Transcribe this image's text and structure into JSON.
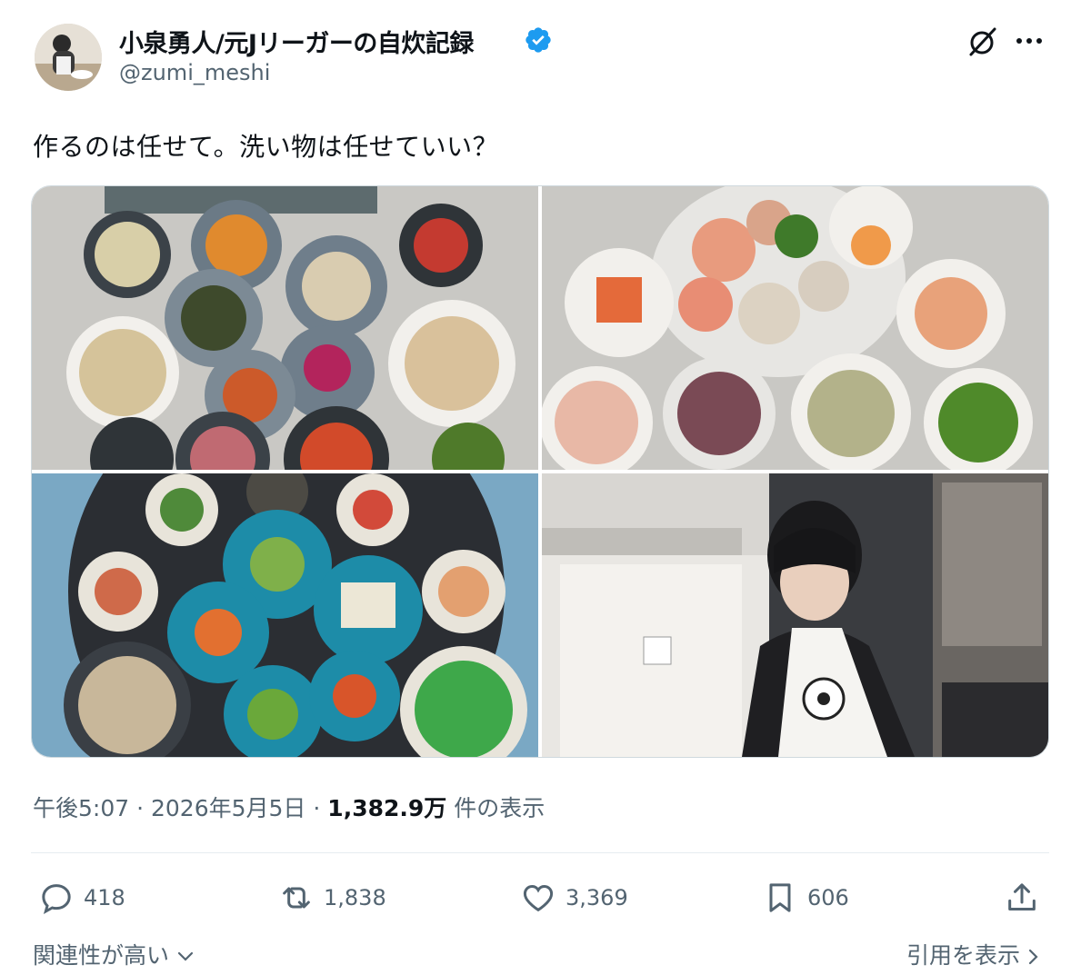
{
  "author": {
    "display_name": "小泉勇人/元Jリーガーの自炊記録",
    "handle": "@zumi_meshi",
    "verified_icon": "verified-badge-icon"
  },
  "header_icons": [
    "grok-icon",
    "more-icon"
  ],
  "tweet": {
    "text": "作るのは任せて。洗い物は任せていい？"
  },
  "media": {
    "images": [
      "food-spread-grey-table",
      "plates-with-egg-and-soup",
      "blue-plates-on-round-tray",
      "man-cooking-in-kitchen"
    ]
  },
  "meta": {
    "time": "午後5:07",
    "sep1": "·",
    "date": "2026年5月5日",
    "sep2": "·",
    "views": "1,382.9万",
    "views_suffix": "件の表示"
  },
  "actions": {
    "reply": "418",
    "retweet": "1,838",
    "like": "3,369",
    "bookmark": "606"
  },
  "footer": {
    "relevant": "関連性が高い",
    "quote": "引用を表示"
  },
  "colors": {
    "verified": "#1d9bf0",
    "secondary_text": "#536471",
    "primary_text": "#0f1419"
  }
}
